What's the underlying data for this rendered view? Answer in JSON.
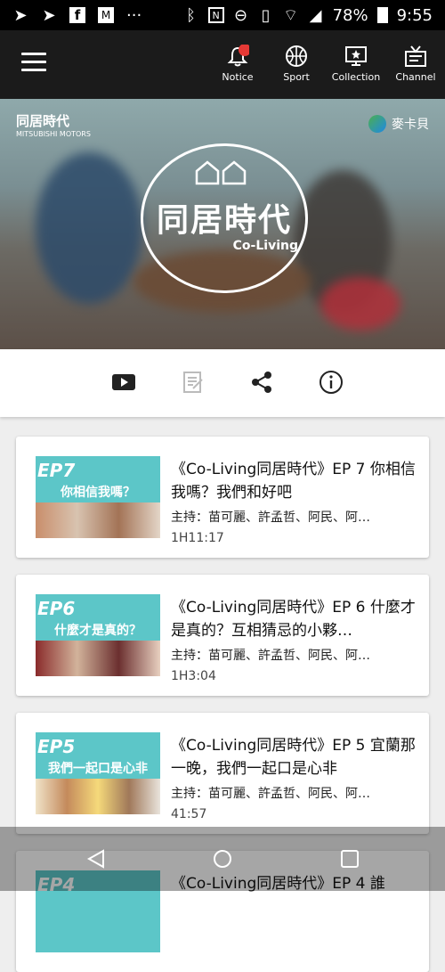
{
  "status": {
    "battery": "78%",
    "time": "9:55"
  },
  "nav": {
    "items": [
      {
        "label": "Notice"
      },
      {
        "label": "Sport"
      },
      {
        "label": "Collection"
      },
      {
        "label": "Channel"
      }
    ]
  },
  "banner": {
    "program_logo": "同居時代",
    "program_sub": "Co-Living",
    "partner": "MITSUBISHI MOTORS",
    "publisher": "麥卡貝"
  },
  "episodes": [
    {
      "thumb_ep": "EP7",
      "thumb_caption": "你相信我嗎？",
      "title": "《Co-Living同居時代》EP 7 你相信我嗎？我們和好吧",
      "host": "主持：苗可麗、許孟哲、阿民、阿…",
      "duration": "1H11:17"
    },
    {
      "thumb_ep": "EP6",
      "thumb_caption": "什麼才是真的？",
      "title": "《Co-Living同居時代》EP 6 什麼才是真的？互相猜忌的小夥…",
      "host": "主持：苗可麗、許孟哲、阿民、阿…",
      "duration": "1H3:04"
    },
    {
      "thumb_ep": "EP5",
      "thumb_caption": "我們一起口是心非",
      "title": "《Co-Living同居時代》EP 5 宜蘭那一晚，我們一起口是心非",
      "host": "主持：苗可麗、許孟哲、阿民、阿…",
      "duration": "41:57"
    },
    {
      "thumb_ep": "EP4",
      "title": "《Co-Living同居時代》EP 4 誰"
    }
  ],
  "colors": {
    "accent": "#e53935",
    "appbar": "#1b1b1b",
    "thumb_bg": "#5cc6c8"
  }
}
